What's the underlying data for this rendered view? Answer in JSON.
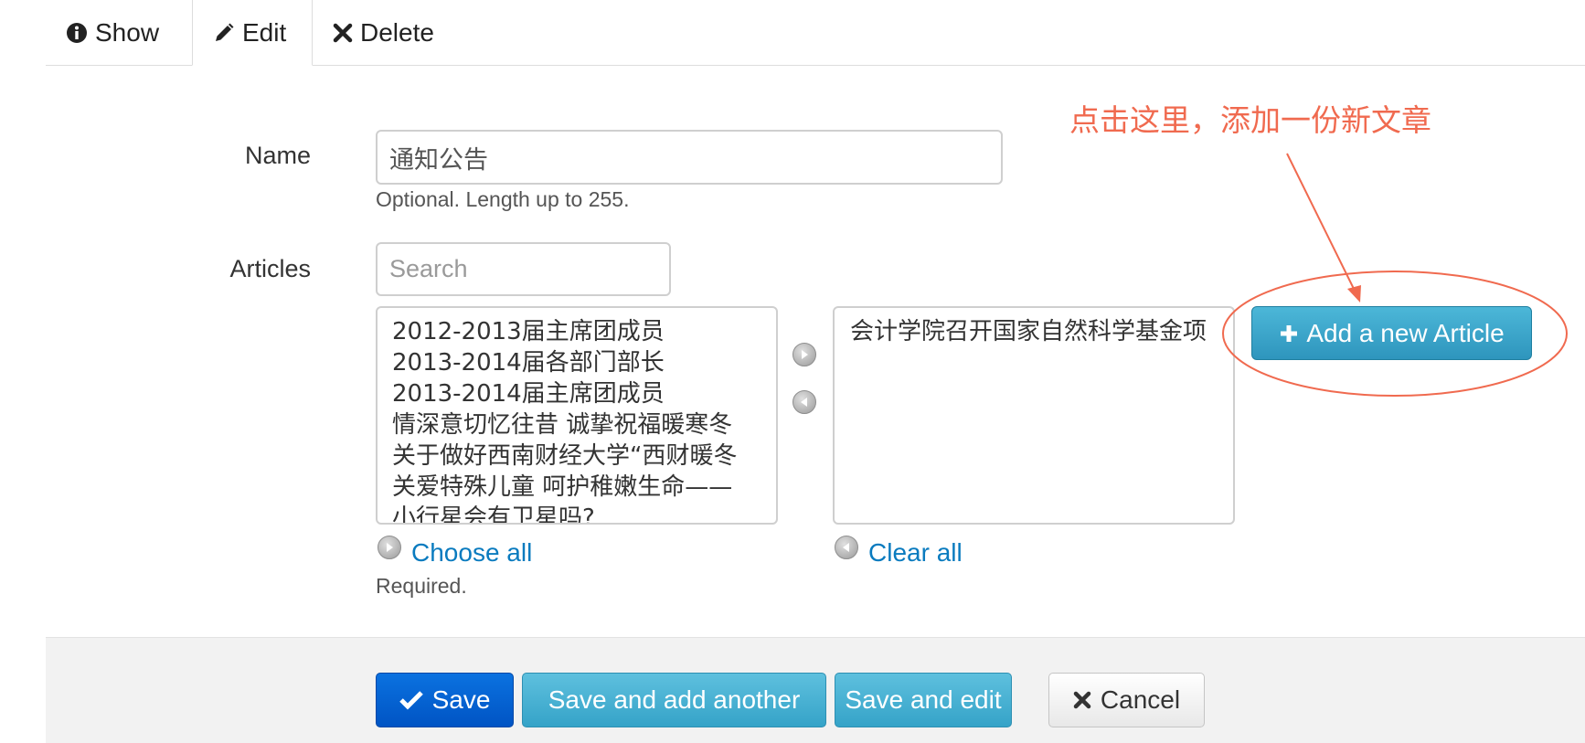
{
  "tabs": [
    {
      "label": "Show",
      "icon": "info-icon"
    },
    {
      "label": "Edit",
      "icon": "pencil-icon"
    },
    {
      "label": "Delete",
      "icon": "x-icon"
    }
  ],
  "form": {
    "name_label": "Name",
    "name_value": "通知公告",
    "name_help": "Optional. Length up to 255.",
    "articles_label": "Articles",
    "search_placeholder": "Search",
    "available_articles": [
      "2012-2013届主席团成员",
      "2013-2014届各部门部长",
      "2013-2014届主席团成员",
      "情深意切忆往昔 诚挚祝福暖寒冬",
      "关于做好西南财经大学“西财暖冬",
      "关爱特殊儿童 呵护稚嫩生命——",
      "小行星会有卫星吗?"
    ],
    "selected_articles": [
      "会计学院召开国家自然科学基金项"
    ],
    "choose_all": "Choose all",
    "clear_all": "Clear all",
    "articles_help": "Required.",
    "add_new_button": "Add a new Article"
  },
  "annotation": {
    "text": "点击这里，添加一份新文章",
    "color": "#f06a4f"
  },
  "footer": {
    "save": "Save",
    "save_add": "Save and add another",
    "save_edit": "Save and edit",
    "cancel": "Cancel"
  },
  "colors": {
    "primary": "#0b6ad9",
    "info": "#3fa9cf",
    "link": "#0a7bbf"
  }
}
